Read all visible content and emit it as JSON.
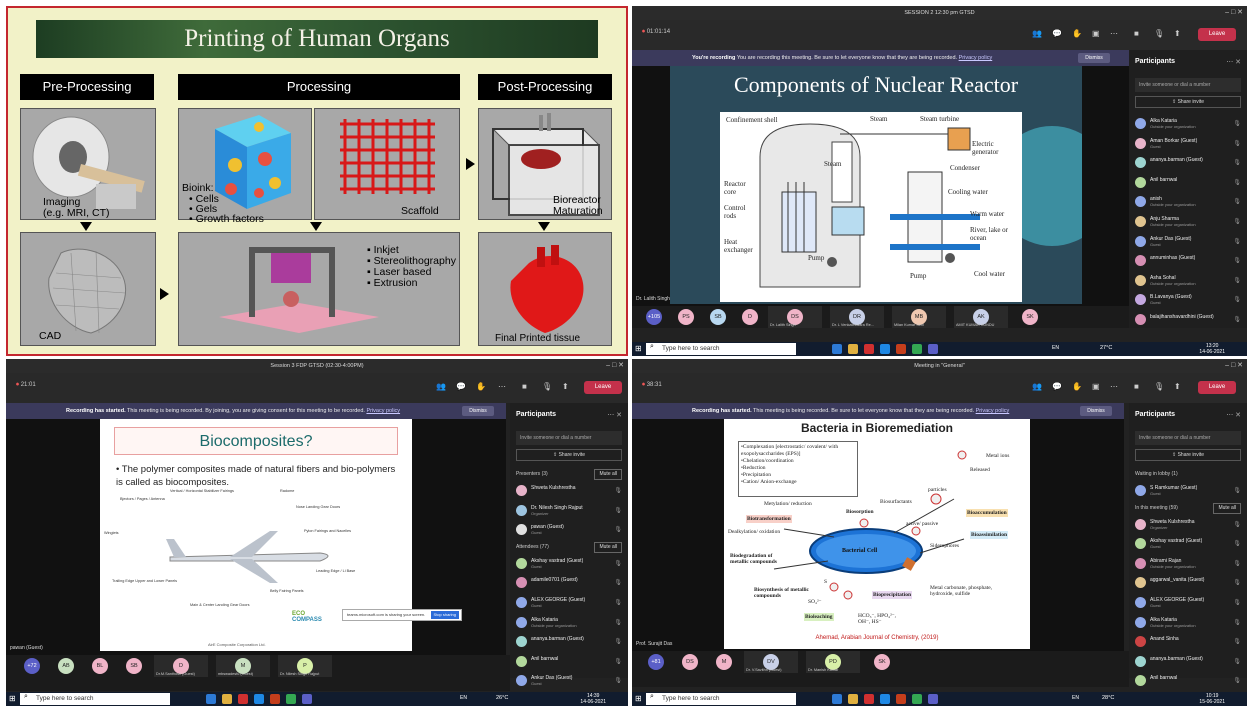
{
  "q1": {
    "title": "Printing of Human Organs",
    "stages": [
      "Pre-Processing",
      "Processing",
      "Post-Processing"
    ],
    "imaging": [
      "Imaging",
      "(e.g. MRI, CT)"
    ],
    "bioink_title": "Bioink:",
    "bioink_items": [
      "• Cells",
      "• Gels",
      "• Growth factors"
    ],
    "scaffold": "Scaffold",
    "bioreactor": [
      "Bioreactor",
      "Maturation"
    ],
    "cad": "CAD",
    "methods": [
      "Inkjet",
      "Stereolithography",
      "Laser based",
      "Extrusion"
    ],
    "final": "Final Printed tissue"
  },
  "q2": {
    "window_title": "SESSION 2 12:30 pm GTSD",
    "timer": "01:01:14",
    "leave": "Leave",
    "rec_bold": "You're recording",
    "rec_text": "You are recording this meeting. Be sure to let everyone know that they are being recorded.",
    "privacy": "Privacy policy",
    "dismiss": "Dismiss",
    "slide_title": "Components of Nuclear Reactor",
    "labels": {
      "confinement": "Confinement shell",
      "steam_top": "Steam",
      "steam_turbine": "Steam turbine",
      "generator": "Electric generator",
      "steam_mid": "Steam",
      "condenser": "Condenser",
      "core": "Reactor core",
      "control": "Control rods",
      "cooling": "Cooling water",
      "warm": "Warm water",
      "river": "River, lake or ocean",
      "heat": "Heat exchanger",
      "pump1": "Pump",
      "pump2": "Pump",
      "cool": "Cool water"
    },
    "presenter": "Dr. Lalith Singh",
    "panel": {
      "title": "Participants",
      "invite": "Invite someone or dial a number",
      "share": "Share invite",
      "people": [
        {
          "name": "Alka Kataria",
          "sub": "Outside your organization",
          "color": "#8fa8e8"
        },
        {
          "name": "Aman Borkar (Guest)",
          "sub": "Guest",
          "color": "#e7b3c9"
        },
        {
          "name": "ananya.barman (Guest)",
          "sub": "",
          "color": "#9dd4d0"
        },
        {
          "name": "Anil barnwal",
          "sub": "",
          "color": "#b2d89c"
        },
        {
          "name": "anish",
          "sub": "Outside your organization",
          "color": "#8fa8e8"
        },
        {
          "name": "Anju Sharma",
          "sub": "Outside your organization",
          "color": "#e0c48f"
        },
        {
          "name": "Ankur Das (Guest)",
          "sub": "Guest",
          "color": "#8fa8e8"
        },
        {
          "name": "annuminhas (Guest)",
          "sub": "",
          "color": "#d68fb3"
        },
        {
          "name": "Asha Sohal",
          "sub": "Outside your organization",
          "color": "#e0c48f"
        },
        {
          "name": "B.Lavanya (Guest)",
          "sub": "Guest",
          "color": "#c4a8e0"
        },
        {
          "name": "balajihanshavardhini (Guest)",
          "sub": "",
          "color": "#d68fb3"
        }
      ]
    },
    "strip": [
      {
        "txt": "+105",
        "color": "#5b5fc7"
      },
      {
        "txt": "PS",
        "color": "#f0b4c8"
      },
      {
        "txt": "SB",
        "color": "#b8d8f0"
      },
      {
        "txt": "D",
        "color": "#f0b4c8"
      },
      {
        "txt": "DS",
        "color": "#f0b4c8"
      },
      {
        "txt": "DR",
        "color": "#c8d0e8"
      },
      {
        "txt": "MB",
        "color": "#f0c8b0"
      },
      {
        "txt": "AK",
        "color": "#c8d0e8"
      },
      {
        "txt": "SK",
        "color": "#f0b4c8"
      }
    ],
    "strip_caps": [
      "Dr. Lalith Singh",
      "Dr. L Venkateswara Re...",
      "Milan Kumar Seni",
      "AMIT KUMAR KUNDU"
    ],
    "task_search": "Type here to search",
    "weather": "27°C",
    "time": "13:20",
    "date": "14-06-2021",
    "lang": "EN"
  },
  "q3": {
    "window_title": "Session 3 FDP GTSD (02:30-4:00PM)",
    "timer": "21:01",
    "leave": "Leave",
    "rec_bold": "Recording has started.",
    "rec_text": "This meeting is being recorded. By joining, you are giving consent for this meeting to be recorded.",
    "privacy": "Privacy policy",
    "dismiss": "Dismiss",
    "slide_title": "Biocomposites?",
    "bullet": "The polymer composites made of natural fibers and bio-polymers is called as biocomposites.",
    "callouts": [
      "Vertical / Horizontal Stabilizer Fairings",
      "Bjectors / Pages / Antenna",
      "Radome",
      "Nose Landing Gear Doors",
      "Winglets",
      "Pylon Fairings and Nacelles",
      "Leading Edge / Li Base",
      "Trailing Edge Upper and Lower Panels",
      "Belly Fairing Panels",
      "Main & Center Landing Gear Doors"
    ],
    "footer_note": "AirE Composite Corporation Ltd.",
    "logo_top": "ECO",
    "logo_bottom": "COMPASS",
    "share_text": "teams.microsoft.com is sharing your screen.",
    "stop_share": "Stop sharing",
    "presenter": "pawan (Guest)",
    "panel": {
      "title": "Participants",
      "invite": "Invite someone or dial a number",
      "share": "Share invite",
      "presenters": "Presenters (3)",
      "attendees": "Attendees (77)",
      "muteall": "Mute all",
      "people": [
        {
          "name": "Shweta Kulshrestha",
          "sub": "",
          "color": "#e7b3c9",
          "sec": "p"
        },
        {
          "name": "Dr. Nilesh Singh Rajput",
          "sub": "Organizer",
          "color": "#9dc4e0",
          "sec": "p"
        },
        {
          "name": "pawan (Guest)",
          "sub": "Guest",
          "color": "#e0e0e0",
          "sec": "p"
        },
        {
          "name": "Akshay vastrad (Guest)",
          "sub": "Guest",
          "color": "#b2d89c",
          "sec": "a"
        },
        {
          "name": "adamile0701 (Guest)",
          "sub": "",
          "color": "#d68fb3",
          "sec": "a"
        },
        {
          "name": "ALEX GEORGE (Guest)",
          "sub": "Guest",
          "color": "#8fa8e8",
          "sec": "a"
        },
        {
          "name": "Alka Kataria",
          "sub": "Outside your organization",
          "color": "#8fa8e8",
          "sec": "a"
        },
        {
          "name": "ananya.barman (Guest)",
          "sub": "",
          "color": "#9dd4d0",
          "sec": "a"
        },
        {
          "name": "Anil barnwal",
          "sub": "",
          "color": "#b2d89c",
          "sec": "a"
        },
        {
          "name": "Ankur Das (Guest)",
          "sub": "Guest",
          "color": "#8fa8e8",
          "sec": "a"
        }
      ]
    },
    "strip": [
      {
        "txt": "+72",
        "color": "#5b5fc7"
      },
      {
        "txt": "AB",
        "color": "#c8e0c0"
      },
      {
        "txt": "BL",
        "color": "#f0b4c8"
      },
      {
        "txt": "SB",
        "color": "#f0b4c8"
      },
      {
        "txt": "D",
        "color": "#f0b4c8"
      },
      {
        "txt": "M",
        "color": "#c8e0c0"
      },
      {
        "txt": "P",
        "color": "#d8f0a8"
      }
    ],
    "strip_caps": [
      "Dr.M.Santhosh (Guest)",
      "mbswadesfu (Guest)",
      "Dr. Nilesh Singh Rajput",
      "pawan (Guest)"
    ],
    "task_search": "Type here to search",
    "weather": "26°C",
    "time": "14:39",
    "date": "14-06-2021",
    "lang": "EN"
  },
  "q4": {
    "window_title": "Meeting in \"General\"",
    "timer": "38:31",
    "leave": "Leave",
    "rec_bold": "Recording has started.",
    "rec_text": "This meeting is being recorded. Be sure to let everyone know that they are being recorded.",
    "privacy": "Privacy policy",
    "dismiss": "Dismiss",
    "slide_title": "Bacteria in Bioremediation",
    "list": [
      "•Complexation [electrostatic/ covalent/ with exopolysaccharides (EPS)]",
      "•Chelation/coordination",
      "•Reduction",
      "•Precipitation",
      "•Cation/ Anion-exchange"
    ],
    "labels": {
      "metal_ions": "Metal ions",
      "released": "Released",
      "particles": "particles",
      "biosurfactants": "Biosurfactants",
      "metylation": "Metylation/ reduction",
      "biosorption": "Biosorption",
      "active": "active/ passive",
      "bioaccumulation": "Bioaccumulation",
      "biotransformation": "Biotransformation",
      "dealkylation": "Dealkylation/ oxidation",
      "cell": "Bacterial Cell",
      "bioassimilation": "Bioassimilation",
      "siderophores": "Siderophores",
      "biodegradation": "Biodegradation of metallic compounds",
      "biosynthesis": "Biosynthesis of metallic compounds",
      "so4": "SO₄²⁻",
      "s": "S",
      "bioprecipitation": "Bioprecipitation",
      "carbonate": "Metal carbonate, phosphate, hydroxide, sulfide",
      "bioleaching": "Bioleaching",
      "hco3": "HCO₃⁻, HPO₄²⁻, OH⁻, HS⁻",
      "citation": "Ahemad, Arabian Journal of Chemistry, (2019)"
    },
    "presenter": "Prof. Surajit Das",
    "panel": {
      "title": "Participants",
      "invite": "Invite someone or dial a number",
      "share": "Share invite",
      "waiting": "Waiting in lobby (1)",
      "inmeeting": "In this meeting (59)",
      "muteall": "Mute all",
      "lobby": {
        "name": "S Ramkumar (Guest)",
        "sub": "Guest",
        "color": "#8fa8e8"
      },
      "people": [
        {
          "name": "Shweta Kulshrestha",
          "sub": "Organizer",
          "color": "#e7b3c9"
        },
        {
          "name": "Akshay vastrad (Guest)",
          "sub": "Guest",
          "color": "#b2d89c"
        },
        {
          "name": "Abirami Rajan",
          "sub": "Outside your organization",
          "color": "#d68fb3"
        },
        {
          "name": "aggarwal_vanita (Guest)",
          "sub": "",
          "color": "#e0c48f"
        },
        {
          "name": "ALEX GEORGE (Guest)",
          "sub": "Guest",
          "color": "#8fa8e8"
        },
        {
          "name": "Alka Kataria",
          "sub": "Outside your organization",
          "color": "#8fa8e8"
        },
        {
          "name": "Anand Sinha",
          "sub": "",
          "color": "#c44"
        },
        {
          "name": "ananya.barman (Guest)",
          "sub": "",
          "color": "#9dd4d0"
        },
        {
          "name": "Anil barnwal",
          "sub": "",
          "color": "#b2d89c"
        }
      ]
    },
    "strip": [
      {
        "txt": "+81",
        "color": "#5b5fc7"
      },
      {
        "txt": "DS",
        "color": "#f0b4c8"
      },
      {
        "txt": "M",
        "color": "#f0b4c8"
      },
      {
        "txt": "DV",
        "color": "#c8d0e8"
      },
      {
        "txt": "PD",
        "color": "#d8f0a8"
      },
      {
        "txt": "SK",
        "color": "#f0b4c8"
      }
    ],
    "strip_caps": [
      "Dr. V.Savithri (Guest)",
      "Dr. Manish Kumar",
      "Viji Chaudhary",
      "Prof. Surajit Das"
    ],
    "task_search": "Type here to search",
    "weather": "28°C",
    "time": "10:19",
    "date": "15-06-2021",
    "lang": "EN"
  }
}
